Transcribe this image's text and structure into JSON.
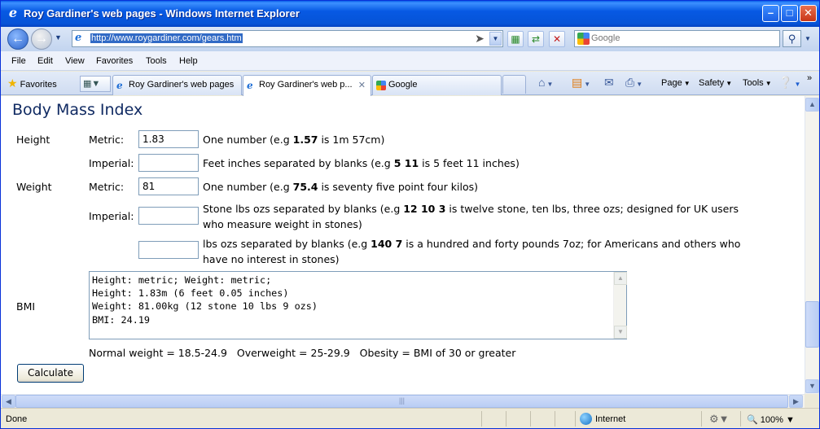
{
  "window": {
    "title": "Roy Gardiner's web pages - Windows Internet Explorer"
  },
  "address": {
    "url": "http://www.roygardiner.com/gears.htm"
  },
  "search": {
    "placeholder": "Google"
  },
  "menu": [
    "File",
    "Edit",
    "View",
    "Favorites",
    "Tools",
    "Help"
  ],
  "toolbar": {
    "favorites": "Favorites",
    "page": "Page",
    "safety": "Safety",
    "tools": "Tools"
  },
  "tabs": [
    {
      "label": "Roy Gardiner's web pages",
      "active": false,
      "icon": "ie-icon"
    },
    {
      "label": "Roy Gardiner's web p...",
      "active": true,
      "icon": "ie-icon"
    },
    {
      "label": "Google",
      "active": false,
      "icon": "google-icon"
    }
  ],
  "page": {
    "title": "Body Mass Index",
    "height_label": "Height",
    "weight_label": "Weight",
    "bmi_label": "BMI",
    "metric_label": "Metric:",
    "imperial_label": "Imperial:",
    "height_metric_value": "1.83",
    "height_imperial_value": "",
    "weight_metric_value": "81",
    "weight_stone_value": "",
    "weight_lbs_value": "",
    "height_metric_desc": {
      "pre": "One number (e.g ",
      "bold": "1.57",
      "post": " is 1m 57cm)"
    },
    "height_imperial_desc": {
      "pre": "Feet inches separated by blanks (e.g ",
      "bold": "5 11",
      "post": " is 5 feet 11 inches)"
    },
    "weight_metric_desc": {
      "pre": "One number (e.g ",
      "bold": "75.4",
      "post": " is seventy five point four kilos)"
    },
    "weight_stone_desc": {
      "pre": "Stone lbs ozs separated by blanks (e.g ",
      "bold": "12 10 3",
      "post": " is twelve stone, ten lbs, three ozs; designed for UK users",
      "line2": "who measure weight in stones)"
    },
    "weight_lbs_desc": {
      "pre": "lbs ozs separated by blanks (e.g ",
      "bold": "140 7",
      "post": " is a hundred and forty pounds 7oz; for Americans and others who",
      "line2": "have no interest in stones)"
    },
    "result_text": "Height: metric; Weight: metric;\nHeight: 1.83m (6 feet 0.05 inches)\nWeight: 81.00kg (12 stone 10 lbs 9 ozs)\nBMI: 24.19",
    "ranges": "Normal weight = 18.5-24.9   Overweight = 25-29.9   Obesity = BMI of 30 or greater",
    "calculate_label": "Calculate"
  },
  "status": {
    "text": "Done",
    "zone": "Internet",
    "zoom": "100%"
  }
}
